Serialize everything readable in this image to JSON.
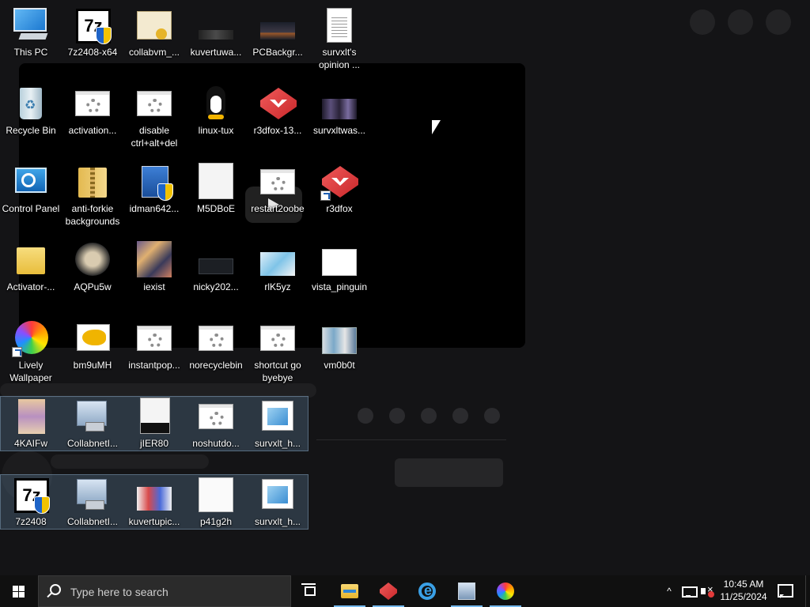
{
  "desktop": {
    "icons": [
      {
        "label": "This PC"
      },
      {
        "label": "7z2408-x64"
      },
      {
        "label": "collabvm_..."
      },
      {
        "label": "kuvertuwa..."
      },
      {
        "label": "PCBackgr..."
      },
      {
        "label": "survxlt's opinion ..."
      },
      {
        "label": "Recycle Bin"
      },
      {
        "label": "activation..."
      },
      {
        "label": "disable ctrl+alt+del"
      },
      {
        "label": "linux-tux"
      },
      {
        "label": "r3dfox-13..."
      },
      {
        "label": "survxltwas..."
      },
      {
        "label": "Control Panel"
      },
      {
        "label": "anti-forkie backgrounds"
      },
      {
        "label": "idman642..."
      },
      {
        "label": "M5DBoE"
      },
      {
        "label": "restart2oobe"
      },
      {
        "label": "r3dfox"
      },
      {
        "label": "Activator-..."
      },
      {
        "label": "AQPu5w"
      },
      {
        "label": "iexist"
      },
      {
        "label": "nicky202..."
      },
      {
        "label": "rlK5yz"
      },
      {
        "label": "vista_pinguin"
      },
      {
        "label": "Lively Wallpaper"
      },
      {
        "label": "bm9uMH"
      },
      {
        "label": "instantpop..."
      },
      {
        "label": "norecyclebin"
      },
      {
        "label": "shortcut go byebye"
      },
      {
        "label": "vm0b0t"
      },
      {
        "label": "4KAIFw"
      },
      {
        "label": "CollabnetI..."
      },
      {
        "label": "jIER80"
      },
      {
        "label": "noshutdo..."
      },
      {
        "label": "survxlt_h..."
      },
      {
        "label": "7z2408"
      },
      {
        "label": "CollabnetI..."
      },
      {
        "label": "kuvertupic..."
      },
      {
        "label": "p41g2h"
      },
      {
        "label": "survxlt_h..."
      }
    ]
  },
  "taskbar": {
    "search_placeholder": "Type here to search",
    "apps": [
      "task-view",
      "file-explorer",
      "r3dfox",
      "internet-explorer",
      "collabnet",
      "lively-wallpaper"
    ],
    "clock_time": "10:45 AM",
    "clock_date": "11/25/2024"
  },
  "colors": {
    "desktop_bg": "#141416",
    "taskbar_bg": "#101010",
    "selection": "#5a7896"
  }
}
